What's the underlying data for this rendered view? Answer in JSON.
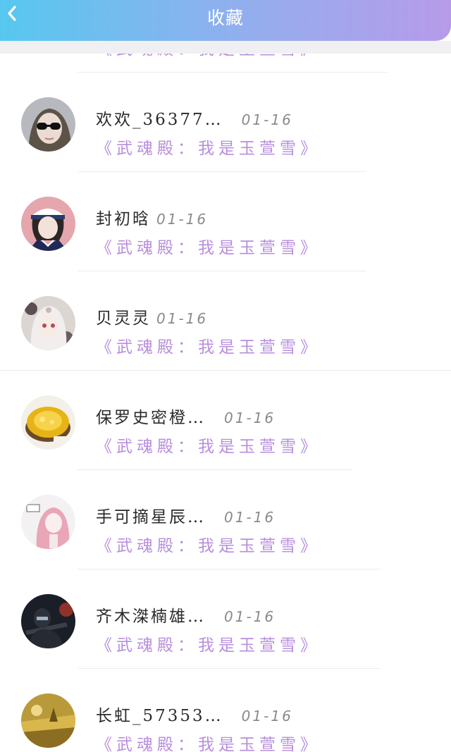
{
  "header": {
    "title": "收藏",
    "back_icon": "chevron-left-icon"
  },
  "colors": {
    "header_gradient_start": "#56c8ef",
    "header_gradient_end": "#b79be9",
    "book_title": "#b78ede",
    "name_text": "#2a2a2a",
    "date_text": "#8a8a8a"
  },
  "items": [
    {
      "name": "",
      "date": "",
      "book": "《武魂殿：我是玉萱雪》",
      "avatar": "avatar-partial-icon"
    },
    {
      "name": "欢欢_36377…",
      "date": "01-16",
      "book": "《武魂殿：我是玉萱雪》",
      "avatar": "avatar-sunglasses-girl-icon"
    },
    {
      "name": "封初晗",
      "date": "01-16",
      "book": "《武魂殿：我是玉萱雪》",
      "avatar": "avatar-sailor-girl-icon"
    },
    {
      "name": "贝灵灵",
      "date": "01-16",
      "book": "《武魂殿：我是玉萱雪》",
      "avatar": "avatar-anime-girl-icon"
    },
    {
      "name": "保罗史密橙…",
      "date": "01-16",
      "book": "《武魂殿：我是玉萱雪》",
      "avatar": "avatar-golden-dessert-icon"
    },
    {
      "name": "手可摘星辰…",
      "date": "01-16",
      "book": "《武魂殿：我是玉萱雪》",
      "avatar": "avatar-pink-hair-girl-icon"
    },
    {
      "name": "齐木滐楠雄…",
      "date": "01-16",
      "book": "《武魂殿：我是玉萱雪》",
      "avatar": "avatar-dark-shooter-icon"
    },
    {
      "name": "长虹_57353…",
      "date": "01-16",
      "book": "《武魂殿：我是玉萱雪》",
      "avatar": "avatar-gold-field-icon"
    }
  ]
}
